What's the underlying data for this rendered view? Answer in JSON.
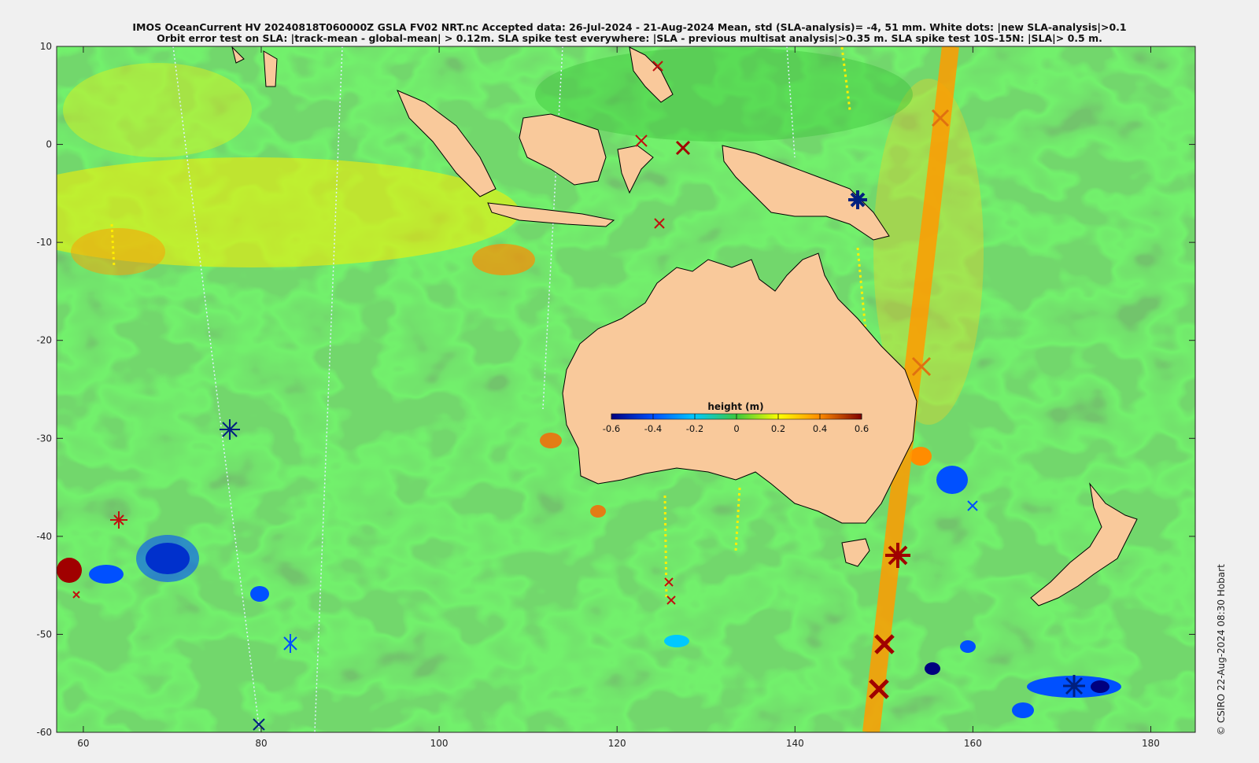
{
  "title": {
    "line1": "IMOS OceanCurrent HV 20240818T060000Z GSLA FV02 NRT.nc  Accepted data: 26-Jul-2024 - 21-Aug-2024 Mean, std (SLA-analysis)= -4, 51 mm. White dots: |new SLA-analysis|>0.1",
    "line2": "Orbit error test on SLA: |track-mean  - global-mean| > 0.12m.  SLA spike test everywhere: |SLA - previous multisat analysis|>0.35 m. SLA spike test 10S-15N: |SLA|> 0.5 m."
  },
  "credit": "© CSIRO 22-Aug-2024 08:30 Hobart",
  "map": {
    "lon_range": [
      57,
      185
    ],
    "lat_range": [
      -60,
      10
    ],
    "x_ticks": [
      "60",
      "80",
      "100",
      "120",
      "140",
      "160",
      "180"
    ],
    "x_tick_values": [
      60,
      80,
      100,
      120,
      140,
      160,
      180
    ],
    "y_ticks": [
      "10",
      "0",
      "-10",
      "-20",
      "-30",
      "-40",
      "-50",
      "-60"
    ],
    "y_tick_values": [
      10,
      0,
      -10,
      -20,
      -30,
      -40,
      -50,
      -60
    ],
    "land_color": "#f9c99b",
    "ocean_base_color": "#3cc83c"
  },
  "colorbar": {
    "title": "height (m)",
    "labels": [
      "-0.6",
      "-0.4",
      "-0.2",
      "0",
      "0.2",
      "0.4",
      "0.6"
    ],
    "values": [
      -0.6,
      -0.4,
      -0.2,
      0,
      0.2,
      0.4,
      0.6
    ],
    "colors": [
      "#00007f",
      "#0050ff",
      "#00c8ff",
      "#3cc83c",
      "#ffff00",
      "#ff8c00",
      "#7f0000"
    ]
  }
}
